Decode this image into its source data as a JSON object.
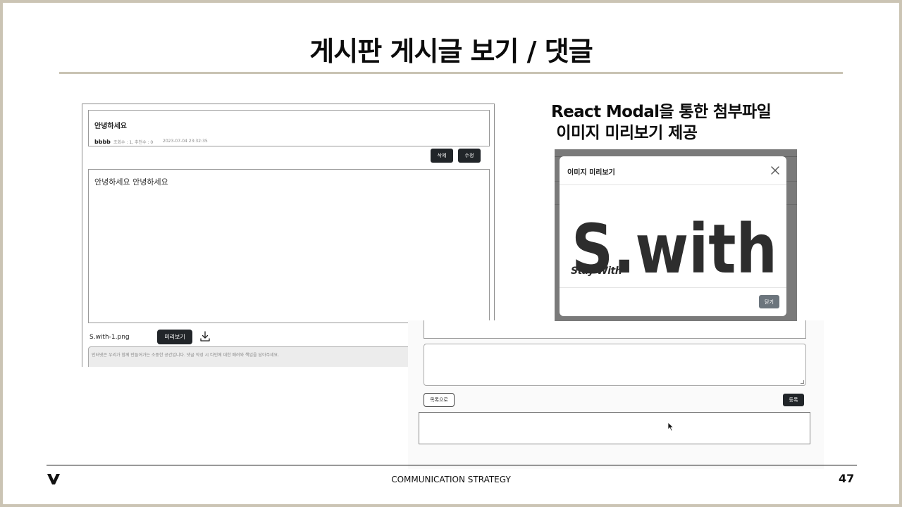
{
  "slide": {
    "title": "게시판 게시글 보기 / 댓글",
    "annotation_line1": "React Modal을 통한 첨부파일",
    "annotation_line2": " 이미지 미리보기 제공"
  },
  "post_view": {
    "title": "안녕하세요",
    "author": "bbbb",
    "meta": "조회수 : 1, 추천수 : 0",
    "date": "2023-07-04 23:32:35",
    "delete_label": "삭제",
    "edit_label": "수정",
    "body": "안녕하세요 안녕하세요",
    "attachment_name": "S.with-1.png",
    "preview_label": "미리보기",
    "download_icon": "download-icon",
    "comment_notice": "인터넷은 우리가 함께 만들어가는 소중한 공간입니다. 댓글 작성 시 타인에 대한 배려와 책임을 담아주세요."
  },
  "modal": {
    "title": "이미지 미리보기",
    "close_icon": "close-icon",
    "logo_text": "S.with",
    "tagline": "Stay With",
    "close_button": "닫기"
  },
  "comment_form": {
    "list_button": "목록으로",
    "register_button": "등록"
  },
  "footer": {
    "center_text": "COMMUNICATION STRATEGY",
    "page_number": "47"
  },
  "colors": {
    "frame": "#cbc4b4",
    "rule": "#c9c3b3",
    "dark_button": "#212529",
    "gray_button": "#6c757d",
    "backdrop": "#7a7a7a"
  }
}
